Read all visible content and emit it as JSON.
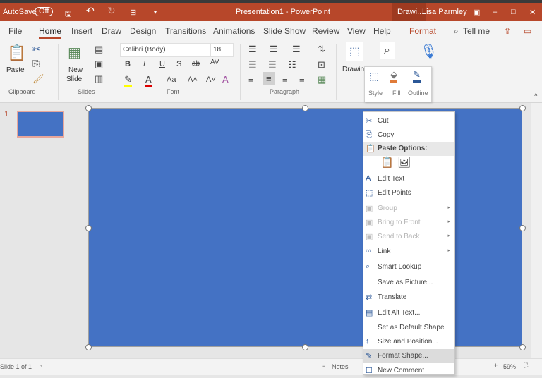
{
  "titlebar": {
    "autosave": "AutoSave",
    "toggle": "Off",
    "title": "Presentation1  -  PowerPoint",
    "context": "Drawi...",
    "user": "Lisa Parmley"
  },
  "tabs": [
    "File",
    "Home",
    "Insert",
    "Draw",
    "Design",
    "Transitions",
    "Animations",
    "Slide Show",
    "Review",
    "View",
    "Help",
    "Format"
  ],
  "tell_me": "Tell me",
  "ribbon": {
    "paste": "Paste",
    "new_slide_1": "New",
    "new_slide_2": "Slide",
    "font_name": "Calibri (Body)",
    "font_size": "18",
    "drawing": "Drawin",
    "groups": {
      "clipboard": "Clipboard",
      "slides": "Slides",
      "font": "Font",
      "paragraph": "Paragraph"
    }
  },
  "mini_toolbar": {
    "style": "Style",
    "fill": "Fill",
    "outline": "Outline"
  },
  "thumbnail_number": "1",
  "context_menu": {
    "items": [
      {
        "label": "Cut",
        "icon": "✂"
      },
      {
        "label": "Copy",
        "icon": "⎘"
      },
      {
        "label": "Paste Options:",
        "icon": "📋"
      },
      {
        "label": "Edit Text",
        "icon": "A"
      },
      {
        "label": "Edit Points",
        "icon": "⬚"
      },
      {
        "label": "Group",
        "icon": "▣"
      },
      {
        "label": "Bring to Front",
        "icon": "▣"
      },
      {
        "label": "Send to Back",
        "icon": "▣"
      },
      {
        "label": "Link",
        "icon": "∞"
      },
      {
        "label": "Smart Lookup",
        "icon": "⌕"
      },
      {
        "label": "Save as Picture...",
        "icon": ""
      },
      {
        "label": "Translate",
        "icon": "⇄"
      },
      {
        "label": "Edit Alt Text...",
        "icon": "▤"
      },
      {
        "label": "Set as Default Shape",
        "icon": ""
      },
      {
        "label": "Size and Position...",
        "icon": "↕"
      },
      {
        "label": "Format Shape...",
        "icon": "✎"
      },
      {
        "label": "New Comment",
        "icon": "☐"
      }
    ]
  },
  "status": {
    "slide": "Slide 1 of 1",
    "notes": "Notes",
    "zoom": "59%"
  },
  "colors": {
    "accent": "#b7472a",
    "shape": "#4472c4"
  }
}
